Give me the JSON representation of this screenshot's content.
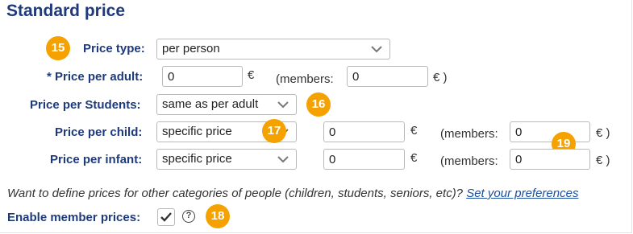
{
  "section": {
    "title": "Standard price"
  },
  "rows": {
    "price_type": {
      "label": "Price type:",
      "value": "per person"
    },
    "adult": {
      "label": "* Price per adult:",
      "value": "0",
      "currency": "€",
      "members_label": "(members:",
      "members_value": "0",
      "members_currency": "€ )"
    },
    "students": {
      "label": "Price per Students:",
      "value": "same as per adult"
    },
    "child": {
      "label": "Price per child:",
      "select_value": "specific price",
      "value": "0",
      "currency": "€",
      "members_label": "(members:",
      "members_value": "0",
      "members_currency": "€ )"
    },
    "infant": {
      "label": "Price per infant:",
      "select_value": "specific price",
      "value": "0",
      "currency": "€",
      "members_label": "(members:",
      "members_value": "0",
      "members_currency": "€ )"
    }
  },
  "info": {
    "text": "Want to define prices for other categories of people (children, students, seniors, etc)? ",
    "link": "Set your preferences"
  },
  "member_prices": {
    "label": "Enable member prices:",
    "checked": true,
    "help_icon": "question-circle-icon"
  },
  "badges": [
    "15",
    "16",
    "17",
    "18",
    "19"
  ],
  "colors": {
    "label": "#1e3a7b",
    "badge": "#f5a200",
    "link": "#1b4fa0"
  }
}
